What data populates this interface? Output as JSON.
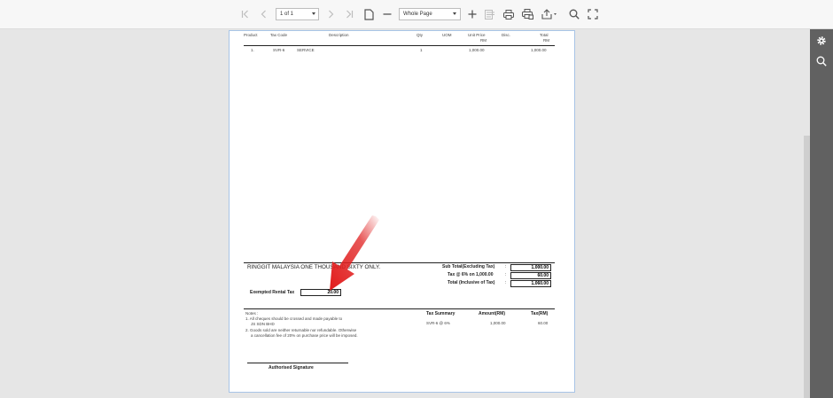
{
  "toolbar": {
    "page_indicator": "1 of 1",
    "zoom_level": "Whole Page",
    "buttons": [
      {
        "name": "first-page",
        "icon": "first-page-icon"
      },
      {
        "name": "previous-page",
        "icon": "chevron-left-icon"
      },
      {
        "name": "next-page",
        "icon": "chevron-right-icon"
      },
      {
        "name": "last-page",
        "icon": "last-page-icon"
      },
      {
        "name": "single-page",
        "icon": "page-icon"
      },
      {
        "name": "zoom-out",
        "icon": "minus-icon"
      },
      {
        "name": "zoom-in",
        "icon": "plus-icon"
      },
      {
        "name": "document-map",
        "icon": "document-map-icon"
      },
      {
        "name": "print",
        "icon": "printer-icon"
      },
      {
        "name": "print-page",
        "icon": "print-page-icon"
      },
      {
        "name": "export",
        "icon": "export-icon"
      },
      {
        "name": "search",
        "icon": "search-icon"
      },
      {
        "name": "fullscreen",
        "icon": "fullscreen-icon"
      }
    ]
  },
  "sidebar": {
    "icons": [
      "gear-icon",
      "search-icon"
    ]
  },
  "document": {
    "table_headers": {
      "product": "Product",
      "tax_code": "Tax Code",
      "description": "Description",
      "qty": "Qty",
      "uom": "UOM",
      "unit_price": "Unit Price",
      "unit_price_currency": "RM",
      "disc": "Disc.",
      "total": "Total",
      "total_currency": "RM"
    },
    "rows": [
      {
        "no": "1.",
        "tax_code": "SVR-6",
        "description": "SERVICE",
        "qty": "1",
        "unit_price": "1,000.00",
        "total": "1,000.00"
      }
    ],
    "amount_in_words": "RINGGIT MALAYSIA ONE THOUSAND SIXTY ONLY.",
    "totals": {
      "sub_total_label": "Sub Total(Excluding Tax)",
      "sub_total_value": "1,000.00",
      "tax_label": "Tax @ 6% on 1,000.00",
      "tax_value": "60.00",
      "total_label": "Total (Inclusive of Tax)",
      "total_value": "1,060.00",
      "colon": ":"
    },
    "exempted_rental_tax_label": "Exempted Rental Tax",
    "exempted_rental_tax_value": "20.00",
    "notes": {
      "title": "Notes :",
      "line1": "1. All cheques should be crossed and made payable to",
      "line2": "JS SDN BHD",
      "line3": "2. Goods sold are neither returnable nor refundable. Otherwise",
      "line4": "a cancellation fee of 20% on purchase price will be imposed."
    },
    "tax_summary": {
      "header": "Tax Summary",
      "amount_header": "Amount(RM)",
      "tax_header": "Tax(RM)",
      "code": "SVR-6 @ 6%",
      "amount": "1,000.00",
      "tax": "60.00"
    },
    "signature_label": "Authorised Signature"
  },
  "colors": {
    "toolbar_bg": "#f7f7f7",
    "viewer_bg": "#e6e6e6",
    "sidebar_bg": "#616161",
    "arrow_red": "#e02020"
  }
}
